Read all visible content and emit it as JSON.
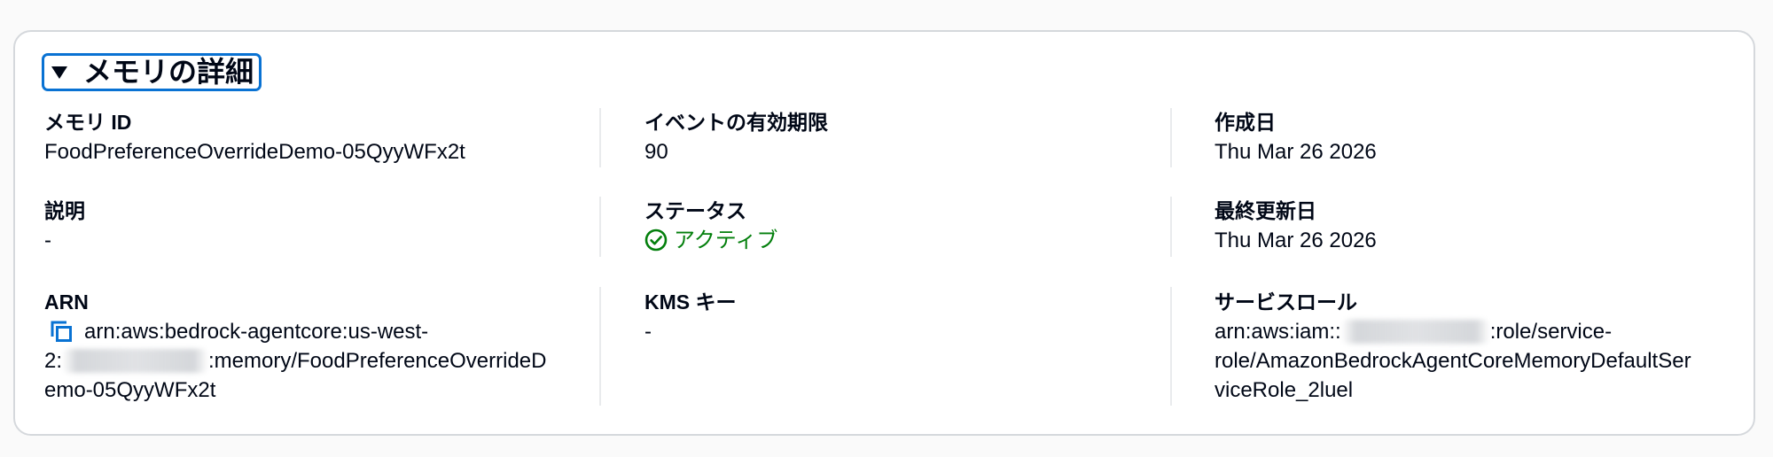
{
  "section": {
    "title": "メモリの詳細",
    "expanded": true,
    "toggle_icon": "caret-down-icon"
  },
  "fields": {
    "memory_id": {
      "label": "メモリ ID",
      "value": "FoodPreferenceOverrideDemo-05QyyWFx2t"
    },
    "event_expiry": {
      "label": "イベントの有効期限",
      "value": "90"
    },
    "created_date": {
      "label": "作成日",
      "value": "Thu Mar 26 2026"
    },
    "description": {
      "label": "説明",
      "value": "-"
    },
    "status": {
      "label": "ステータス",
      "value": "アクティブ",
      "icon": "status-positive-icon"
    },
    "last_updated": {
      "label": "最終更新日",
      "value": "Thu Mar 26 2026"
    },
    "arn": {
      "label": "ARN",
      "copy_icon": "copy-icon",
      "value_prefix": "arn:aws:bedrock-agentcore:us-west-2:",
      "value_suffix": ":memory/FoodPreferenceOverrideDemo-05QyyWFx2t"
    },
    "kms_key": {
      "label": "KMS キー",
      "value": "-"
    },
    "service_role": {
      "label": "サービスロール",
      "value_prefix": "arn:aws:iam::",
      "value_suffix": ":role/service-role/AmazonBedrockAgentCoreMemoryDefaultServiceRole_2luel"
    }
  },
  "colors": {
    "text": "#000716",
    "accent": "#0972d3",
    "success": "#037f0c",
    "divider": "#e9ebed",
    "card_border": "#d5d8dc",
    "background": "#fafafa"
  }
}
